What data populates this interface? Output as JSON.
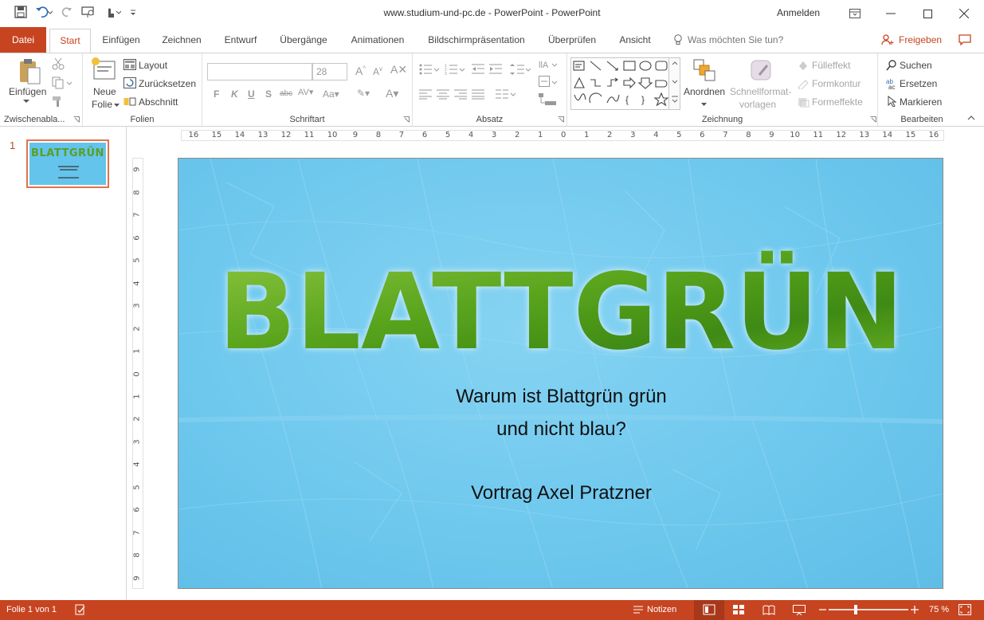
{
  "window": {
    "title": "www.studium-und-pc.de  -  PowerPoint  -  PowerPoint",
    "signin": "Anmelden"
  },
  "tabs": {
    "file": "Datei",
    "items": [
      "Start",
      "Einfügen",
      "Zeichnen",
      "Entwurf",
      "Übergänge",
      "Animationen",
      "Bildschirmpräsentation",
      "Überprüfen",
      "Ansicht"
    ],
    "active": "Start",
    "tell_me": "Was möchten Sie tun?",
    "share": "Freigeben"
  },
  "ribbon": {
    "clipboard": {
      "label": "Zwischenabla...",
      "paste": "Einfügen"
    },
    "slides": {
      "label": "Folien",
      "new_slide_1": "Neue",
      "new_slide_2": "Folie",
      "layout": "Layout",
      "reset": "Zurücksetzen",
      "section": "Abschnitt"
    },
    "font": {
      "label": "Schriftart",
      "font_name": "",
      "font_size": "28",
      "bold": "F",
      "italic": "K",
      "underline": "U",
      "shadow": "S",
      "strike": "abc"
    },
    "paragraph": {
      "label": "Absatz"
    },
    "drawing": {
      "label": "Zeichnung",
      "arrange": "Anordnen",
      "quick_styles_1": "Schnellformat-",
      "quick_styles_2": "vorlagen",
      "fill": "Fülleffekt",
      "outline": "Formkontur",
      "effects": "Formeffekte"
    },
    "editing": {
      "label": "Bearbeiten",
      "find": "Suchen",
      "replace": "Ersetzen",
      "select": "Markieren"
    }
  },
  "ruler": {
    "h_ticks": [
      "16",
      "15",
      "14",
      "13",
      "12",
      "11",
      "10",
      "9",
      "8",
      "7",
      "6",
      "5",
      "4",
      "3",
      "2",
      "1",
      "0",
      "1",
      "2",
      "3",
      "4",
      "5",
      "6",
      "7",
      "8",
      "9",
      "10",
      "11",
      "12",
      "13",
      "14",
      "15",
      "16"
    ],
    "v_ticks": [
      "9",
      "8",
      "7",
      "6",
      "5",
      "4",
      "3",
      "2",
      "1",
      "0",
      "1",
      "2",
      "3",
      "4",
      "5",
      "6",
      "7",
      "8",
      "9"
    ]
  },
  "thumbnails": [
    {
      "number": "1",
      "title": "BLATTGRÜN"
    }
  ],
  "slide": {
    "title": "BLATTGRÜN",
    "line1": "Warum ist Blattgrün grün",
    "line2": "und nicht blau?",
    "line3": "Vortrag Axel Pratzner"
  },
  "status": {
    "slide_info": "Folie 1 von 1",
    "notes": "Notizen",
    "zoom": "75 %",
    "zoom_level": 0.75
  },
  "colors": {
    "accent": "#c74421",
    "slide_bg": "#6ec8ee",
    "leaf_green": "#5aa51e"
  }
}
